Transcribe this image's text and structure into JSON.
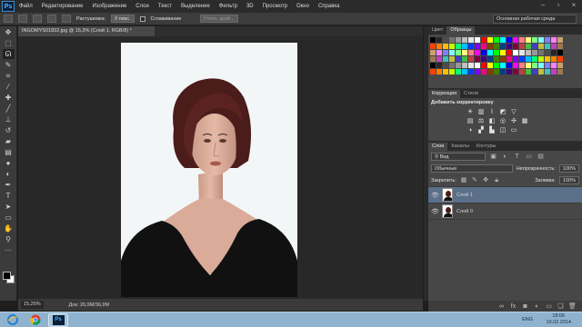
{
  "menu": {
    "logo": "Ps",
    "items": [
      "Файл",
      "Редактирование",
      "Изображение",
      "Слои",
      "Текст",
      "Выделение",
      "Фильтр",
      "3D",
      "Просмотр",
      "Окно",
      "Справка"
    ]
  },
  "options": {
    "feather_label": "Растушевка:",
    "feather_value": "0 пикс.",
    "antialias_label": "Сглаживание",
    "refine_label": "Уточн. край...",
    "workspace_value": "Основная рабочая среда"
  },
  "document": {
    "tab_title": "INGOMYS01832.jpg @ 15,3% (Слой 1, RGB/8) *",
    "zoom": "15,25%",
    "doc_info": "Док: 20,9M/36,9M"
  },
  "swatches_panel": {
    "tabs": [
      "Цвет",
      "Образцы"
    ],
    "colors": [
      "#000000",
      "#262626",
      "#4d4d4d",
      "#737373",
      "#999999",
      "#bfbfbf",
      "#e6e6e6",
      "#ffffff",
      "#ff0000",
      "#ffff00",
      "#00ff00",
      "#00ffff",
      "#0000ff",
      "#ff00ff",
      "#ff8080",
      "#ffff80",
      "#80ff80",
      "#80ffff",
      "#8080ff",
      "#ff80ff",
      "#c8a070"
    ]
  },
  "adjustments_panel": {
    "tabs": [
      "Коррекция",
      "Стили"
    ],
    "title": "Добавить корректировку",
    "icons": [
      "brightness-icon",
      "levels-icon",
      "curves-icon",
      "exposure-icon",
      "vibrance-icon",
      "hue-sat-icon",
      "color-balance-icon",
      "black-white-icon",
      "photo-filter-icon",
      "channel-mixer-icon",
      "color-lookup-icon",
      "invert-icon",
      "posterize-icon",
      "threshold-icon",
      "selective-color-icon",
      "gradient-map-icon"
    ]
  },
  "layers_panel": {
    "tabs": [
      "Слои",
      "Каналы",
      "Контуры"
    ],
    "kind_label": "Вид",
    "blend_mode": "Обычные",
    "opacity_label": "Непрозрачность:",
    "opacity_value": "100%",
    "lock_label": "Закрепить:",
    "fill_label": "Заливка:",
    "fill_value": "100%",
    "layers": [
      {
        "name": "Слой 1",
        "selected": true
      },
      {
        "name": "Слой 0",
        "selected": false
      }
    ],
    "footer_icons": [
      "link-icon",
      "fx-icon",
      "mask-icon",
      "adjustment-layer-icon",
      "group-icon",
      "new-layer-icon",
      "trash-icon"
    ],
    "fx_label": "fx"
  },
  "taskbar": {
    "apps": [
      "ie-icon",
      "chrome-icon",
      "photoshop-icon"
    ],
    "ps_label": "Ps",
    "lang": "ENG",
    "time": "18:06",
    "date": "19.02.2014"
  },
  "colors": {
    "accent": "#3b8fd6",
    "selected_layer": "#5a6f8a",
    "taskbar": "#8fb3cf"
  }
}
